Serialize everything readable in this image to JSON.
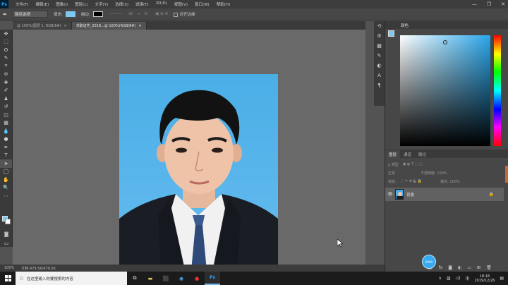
{
  "app": {
    "logo": "Ps"
  },
  "menu": [
    "文件(F)",
    "编辑(E)",
    "图像(I)",
    "图层(L)",
    "文字(Y)",
    "选择(S)",
    "滤镜(T)",
    "3D(D)",
    "视图(V)",
    "窗口(W)",
    "帮助(H)"
  ],
  "window_controls": {
    "minimize": "—",
    "maximize": "❐",
    "close": "✕"
  },
  "options": {
    "shape_mode": "路径选项",
    "fill_label": "填充:",
    "stroke_label": "描边:",
    "auto_select_label": "对齐边缘",
    "fill_color": "#7ec8f0",
    "stroke_color": "#000000"
  },
  "tabs": [
    {
      "label": "@ 100%(图层 1, RGB/8#)",
      "close": "✕"
    },
    {
      "label": "求职证件_2018...@ 100%(RGB/8#)",
      "close": "✕"
    }
  ],
  "status": {
    "zoom": "100%",
    "doc": "文档:479.5K/479.5K"
  },
  "color_panel": {
    "title": "颜色",
    "fg": "#7ec8f0",
    "bg": "#ffffff"
  },
  "layers_panel": {
    "tabs": [
      "图层",
      "通道",
      "路径"
    ],
    "kind_label": "ρ 类型",
    "mode_label": "正常",
    "opacity_label": "不透明度: 100%",
    "lock_label": "锁定:",
    "fill_label": "填充: 100%",
    "layer_name": "背景"
  },
  "taskbar": {
    "search_placeholder": "在这里输入你要搜索的内容",
    "bubble": "0000",
    "time": "18:18",
    "date": "2019/12/26"
  }
}
